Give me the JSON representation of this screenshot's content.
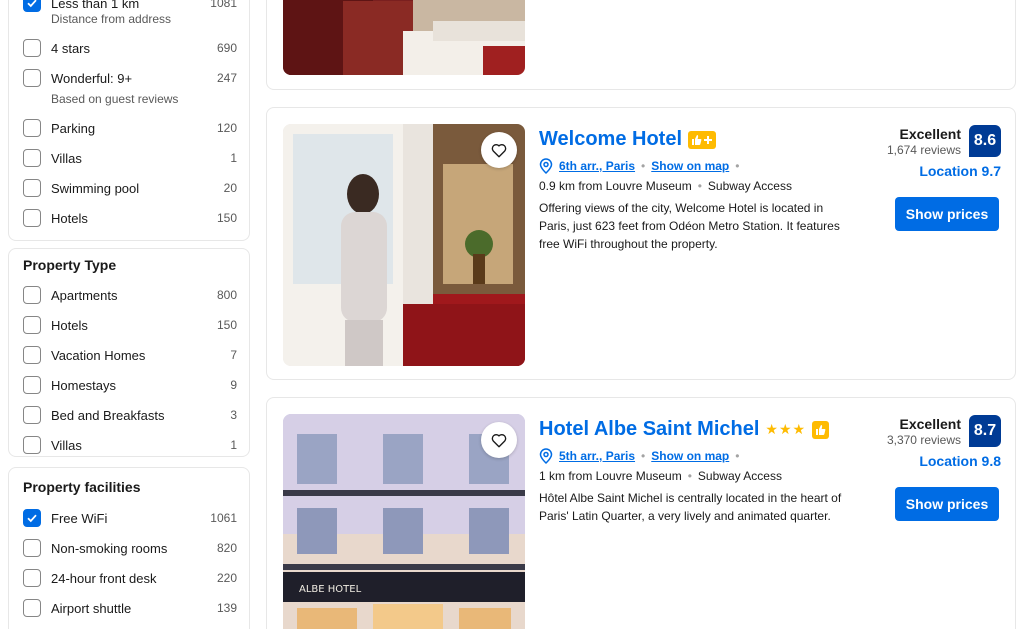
{
  "filters": {
    "top_partial": {
      "label": "Less than 1 km",
      "count": "1081",
      "checked": true
    },
    "distance_subhead": "Distance from address",
    "rating_items": [
      {
        "label": "4 stars",
        "count": "690"
      },
      {
        "label": "Wonderful: 9+",
        "count": "247"
      }
    ],
    "reviews_subhead": "Based on guest reviews",
    "facility_items_top": [
      {
        "label": "Parking",
        "count": "120"
      },
      {
        "label": "Villas",
        "count": "1"
      },
      {
        "label": "Swimming pool",
        "count": "20"
      },
      {
        "label": "Hotels",
        "count": "150"
      }
    ],
    "property_type": {
      "title": "Property Type",
      "items": [
        {
          "label": "Apartments",
          "count": "800"
        },
        {
          "label": "Hotels",
          "count": "150"
        },
        {
          "label": "Vacation Homes",
          "count": "7"
        },
        {
          "label": "Homestays",
          "count": "9"
        },
        {
          "label": "Bed and Breakfasts",
          "count": "3"
        },
        {
          "label": "Villas",
          "count": "1"
        }
      ]
    },
    "property_facilities": {
      "title": "Property facilities",
      "items": [
        {
          "label": "Free WiFi",
          "count": "1061",
          "checked": true
        },
        {
          "label": "Non-smoking rooms",
          "count": "820"
        },
        {
          "label": "24-hour front desk",
          "count": "220"
        },
        {
          "label": "Airport shuttle",
          "count": "139"
        }
      ]
    }
  },
  "hotels": [
    {
      "name": "Welcome Hotel",
      "district": "6th arr., Paris",
      "map_link": "Show on map",
      "distance": "0.9 km from Louvre Museum",
      "subway": "Subway Access",
      "description": "Offering views of the city, Welcome Hotel is located in Paris, just 623 feet from Odéon Metro Station. It features free WiFi throughout the property.",
      "rating_word": "Excellent",
      "reviews": "1,674 reviews",
      "score": "8.6",
      "location_score": "Location 9.7",
      "button": "Show prices"
    },
    {
      "name": "Hotel Albe Saint Michel",
      "district": "5th arr., Paris",
      "map_link": "Show on map",
      "distance": "1 km from Louvre Museum",
      "subway": "Subway Access",
      "description": "Hôtel Albe Saint Michel is centrally located in the heart of Paris' Latin Quarter, a very lively and animated quarter.",
      "rating_word": "Excellent",
      "reviews": "3,370 reviews",
      "score": "8.7",
      "location_score": "Location 9.8",
      "button": "Show prices",
      "sign_text": "ALBE HOTEL",
      "star_rating": 3
    }
  ],
  "colors": {
    "brand_blue": "#006ce4",
    "score_navy": "#003b95",
    "star_yellow": "#febb02"
  }
}
